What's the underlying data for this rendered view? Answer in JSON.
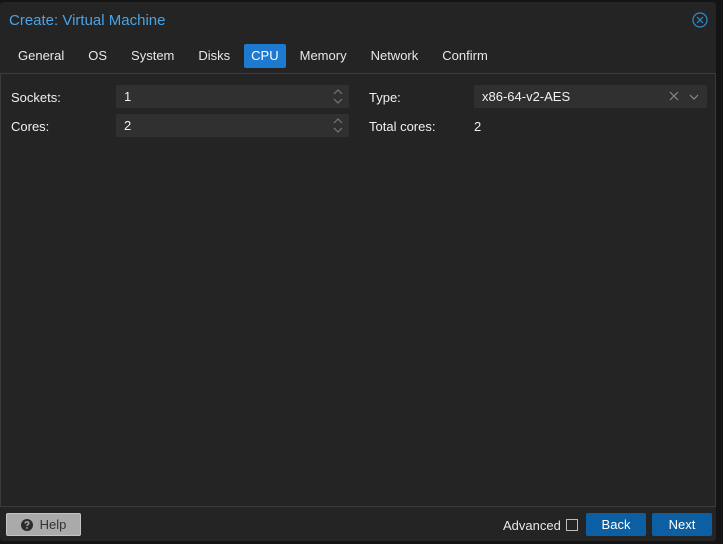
{
  "window": {
    "title": "Create: Virtual Machine",
    "close_icon": "circle-x-icon",
    "accent_color": "#1e7ad1",
    "title_color": "#4ba3e3"
  },
  "tabs": [
    {
      "label": "General",
      "active": false
    },
    {
      "label": "OS",
      "active": false
    },
    {
      "label": "System",
      "active": false
    },
    {
      "label": "Disks",
      "active": false
    },
    {
      "label": "CPU",
      "active": true
    },
    {
      "label": "Memory",
      "active": false
    },
    {
      "label": "Network",
      "active": false
    },
    {
      "label": "Confirm",
      "active": false
    }
  ],
  "form": {
    "sockets": {
      "label": "Sockets:",
      "value": "1"
    },
    "cores": {
      "label": "Cores:",
      "value": "2"
    },
    "type": {
      "label": "Type:",
      "value": "x86-64-v2-AES"
    },
    "total_cores": {
      "label": "Total cores:",
      "value": "2"
    }
  },
  "footer": {
    "help_label": "Help",
    "advanced_label": "Advanced",
    "advanced_checked": false,
    "back_label": "Back",
    "next_label": "Next",
    "button_color": "#0c5fa3"
  }
}
